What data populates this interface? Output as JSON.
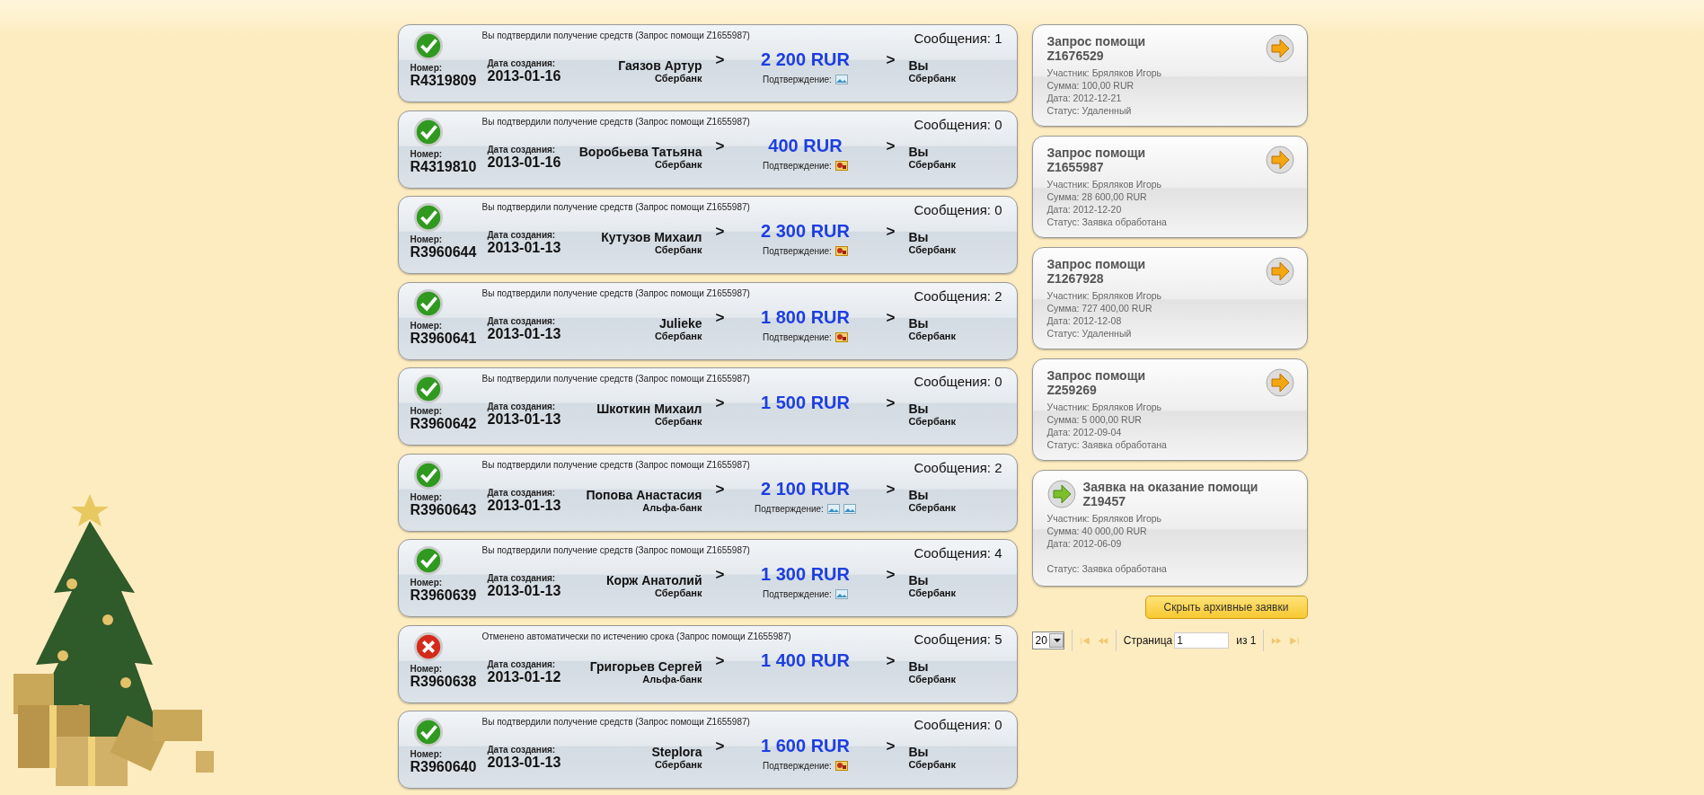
{
  "transfers": [
    {
      "kind": "confirmed",
      "note": "Вы подтвердили получение средств (Запрос помощи Z1655987)",
      "messages": "Сообщения: 1",
      "number_label": "Номер:",
      "number": "R4319809",
      "date_label": "Дата создания:",
      "date": "2013-01-16",
      "sender": {
        "name": "Гаязов Артур",
        "bank": "Сбербанк"
      },
      "arrows": [
        ">",
        ">"
      ],
      "amount": "2 200 RUR",
      "confirmation_label": "Подтверждение:",
      "confirmations": [
        {
          "kind": "image"
        }
      ],
      "recipient": {
        "name": "Вы",
        "bank": "Сбербанк"
      }
    },
    {
      "kind": "confirmed",
      "note": "Вы подтвердили получение средств (Запрос помощи Z1655987)",
      "messages": "Сообщения: 0",
      "number_label": "Номер:",
      "number": "R4319810",
      "date_label": "Дата создания:",
      "date": "2013-01-16",
      "sender": {
        "name": "Воробьева Татьяна",
        "bank": "Сбербанк"
      },
      "arrows": [
        ">",
        ">"
      ],
      "amount": "400 RUR",
      "confirmation_label": "Подтверждение:",
      "confirmations": [
        {
          "kind": "stamp"
        }
      ],
      "recipient": {
        "name": "Вы",
        "bank": "Сбербанк"
      }
    },
    {
      "kind": "confirmed",
      "note": "Вы подтвердили получение средств (Запрос помощи Z1655987)",
      "messages": "Сообщения: 0",
      "number_label": "Номер:",
      "number": "R3960644",
      "date_label": "Дата создания:",
      "date": "2013-01-13",
      "sender": {
        "name": "Кутузов Михаил",
        "bank": "Сбербанк"
      },
      "arrows": [
        ">",
        ">"
      ],
      "amount": "2 300 RUR",
      "confirmation_label": "Подтверждение:",
      "confirmations": [
        {
          "kind": "stamp"
        }
      ],
      "recipient": {
        "name": "Вы",
        "bank": "Сбербанк"
      }
    },
    {
      "kind": "confirmed",
      "note": "Вы подтвердили получение средств (Запрос помощи Z1655987)",
      "messages": "Сообщения: 2",
      "number_label": "Номер:",
      "number": "R3960641",
      "date_label": "Дата создания:",
      "date": "2013-01-13",
      "sender": {
        "name": "Julieke",
        "bank": "Сбербанк"
      },
      "arrows": [
        ">",
        ">"
      ],
      "amount": "1 800 RUR",
      "confirmation_label": "Подтверждение:",
      "confirmations": [
        {
          "kind": "stamp"
        }
      ],
      "recipient": {
        "name": "Вы",
        "bank": "Сбербанк"
      }
    },
    {
      "kind": "confirmed",
      "note": "Вы подтвердили получение средств (Запрос помощи Z1655987)",
      "messages": "Сообщения: 0",
      "number_label": "Номер:",
      "number": "R3960642",
      "date_label": "Дата создания:",
      "date": "2013-01-13",
      "sender": {
        "name": "Шкоткин Михаил",
        "bank": "Сбербанк"
      },
      "arrows": [
        ">",
        ">"
      ],
      "amount": "1 500 RUR",
      "recipient": {
        "name": "Вы",
        "bank": "Сбербанк"
      }
    },
    {
      "kind": "confirmed",
      "note": "Вы подтвердили получение средств (Запрос помощи Z1655987)",
      "messages": "Сообщения: 2",
      "number_label": "Номер:",
      "number": "R3960643",
      "date_label": "Дата создания:",
      "date": "2013-01-13",
      "sender": {
        "name": "Попова Анастасия",
        "bank": "Альфа-банк"
      },
      "arrows": [
        ">",
        ">"
      ],
      "amount": "2 100 RUR",
      "confirmation_label": "Подтверждение:",
      "confirmations": [
        {
          "kind": "image"
        },
        {
          "kind": "image"
        }
      ],
      "recipient": {
        "name": "Вы",
        "bank": "Сбербанк"
      }
    },
    {
      "kind": "confirmed",
      "note": "Вы подтвердили получение средств (Запрос помощи Z1655987)",
      "messages": "Сообщения: 4",
      "number_label": "Номер:",
      "number": "R3960639",
      "date_label": "Дата создания:",
      "date": "2013-01-13",
      "sender": {
        "name": "Корж Анатолий",
        "bank": "Сбербанк"
      },
      "arrows": [
        ">",
        ">"
      ],
      "amount": "1 300 RUR",
      "confirmation_label": "Подтверждение:",
      "confirmations": [
        {
          "kind": "image"
        }
      ],
      "recipient": {
        "name": "Вы",
        "bank": "Сбербанк"
      }
    },
    {
      "kind": "cancelled",
      "note": "Отменено автоматически по истечению срока (Запрос помощи Z1655987)",
      "messages": "Сообщения: 5",
      "number_label": "Номер:",
      "number": "R3960638",
      "date_label": "Дата создания:",
      "date": "2013-01-12",
      "sender": {
        "name": "Григорьев Сергей",
        "bank": "Альфа-банк"
      },
      "arrows": [
        ">",
        ">"
      ],
      "amount": "1 400 RUR",
      "recipient": {
        "name": "Вы",
        "bank": "Сбербанк"
      }
    },
    {
      "kind": "confirmed",
      "note": "Вы подтвердили получение средств (Запрос помощи Z1655987)",
      "messages": "Сообщения: 0",
      "number_label": "Номер:",
      "number": "R3960640",
      "date_label": "Дата создания:",
      "date": "2013-01-13",
      "sender": {
        "name": "Steplora",
        "bank": "Сбербанк"
      },
      "arrows": [
        ">",
        ">"
      ],
      "amount": "1 600 RUR",
      "confirmation_label": "Подтверждение:",
      "confirmations": [
        {
          "kind": "stamp"
        }
      ],
      "recipient": {
        "name": "Вы",
        "bank": "Сбербанк"
      }
    }
  ],
  "requests": [
    {
      "kind": "request",
      "title": "Запрос помощи",
      "code": "Z1676529",
      "lines": [
        "Участник: Бряляков Игорь",
        "Сумма: 100,00 RUR",
        "Дата: 2012-12-21"
      ],
      "status": "Статус: Удаленный"
    },
    {
      "kind": "request",
      "title": "Запрос помощи",
      "code": "Z1655987",
      "lines": [
        "Участник: Бряляков Игорь",
        "Сумма: 28 600,00 RUR",
        "Дата: 2012-12-20"
      ],
      "status": "Статус: Заявка обработана"
    },
    {
      "kind": "request",
      "title": "Запрос помощи",
      "code": "Z1267928",
      "lines": [
        "Участник: Бряляков Игорь",
        "Сумма: 727 400,00 RUR",
        "Дата: 2012-12-08"
      ],
      "status": "Статус: Удаленный"
    },
    {
      "kind": "request",
      "title": "Запрос помощи",
      "code": "Z259269",
      "lines": [
        "Участник: Бряляков Игорь",
        "Сумма: 5 000,00 RUR",
        "Дата: 2012-09-04"
      ],
      "status": "Статус: Заявка обработана"
    },
    {
      "kind": "offer",
      "title": "Заявка на оказание помощи",
      "code": "Z19457",
      "lines": [
        "Участник: Бряляков Игорь",
        "Сумма: 40 000,00 RUR",
        "Дата: 2012-06-09"
      ],
      "status": "Статус: Заявка обработана"
    }
  ],
  "hide_archive_button": "Скрыть архивные заявки",
  "pagination": {
    "page_size": "20",
    "page_label": "Страница",
    "page": "1",
    "of_label": "из 1",
    "nav": [
      {
        "kind": "first",
        "disabled": true
      },
      {
        "kind": "prev",
        "disabled": true
      },
      {
        "kind": "next",
        "disabled": true
      },
      {
        "kind": "last",
        "disabled": true
      }
    ]
  }
}
